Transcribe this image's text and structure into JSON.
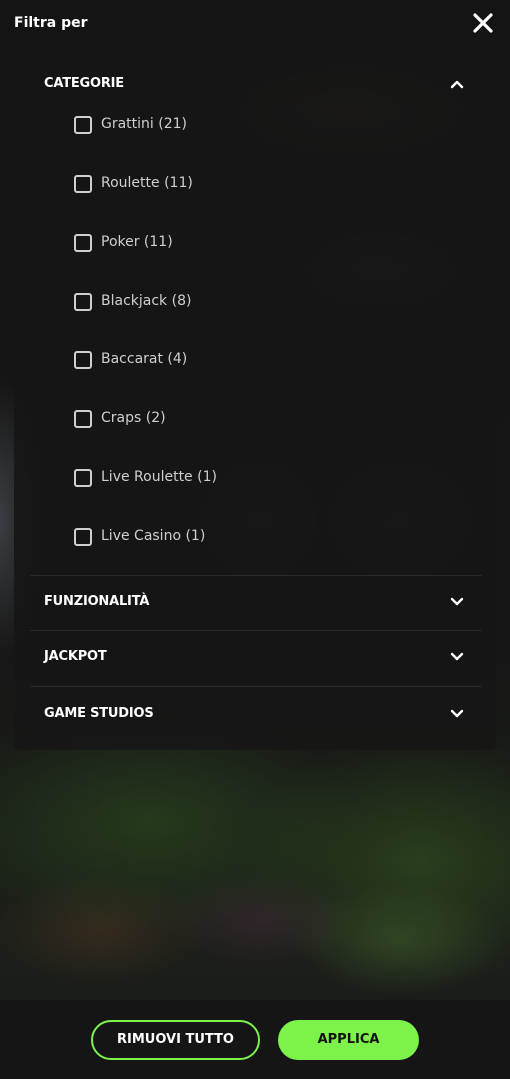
{
  "header": {
    "title": "Filtra per",
    "close_icon": "close-icon"
  },
  "sections": [
    {
      "label": "CATEGORIE",
      "expanded": true,
      "options": [
        {
          "label": "Grattini (21)",
          "checked": false
        },
        {
          "label": "Roulette (11)",
          "checked": false
        },
        {
          "label": "Poker (11)",
          "checked": false
        },
        {
          "label": "Blackjack (8)",
          "checked": false
        },
        {
          "label": "Baccarat (4)",
          "checked": false
        },
        {
          "label": "Craps (2)",
          "checked": false
        },
        {
          "label": "Live Roulette (1)",
          "checked": false
        },
        {
          "label": "Live Casino (1)",
          "checked": false
        }
      ]
    },
    {
      "label": "FUNZIONALITÀ",
      "expanded": false
    },
    {
      "label": "JACKPOT",
      "expanded": false
    },
    {
      "label": "GAME STUDIOS",
      "expanded": false
    }
  ],
  "footer": {
    "clear_label": "RIMUOVI TUTTO",
    "apply_label": "APPLICA"
  },
  "colors": {
    "accent": "#7cf24a",
    "background": "#141414"
  }
}
